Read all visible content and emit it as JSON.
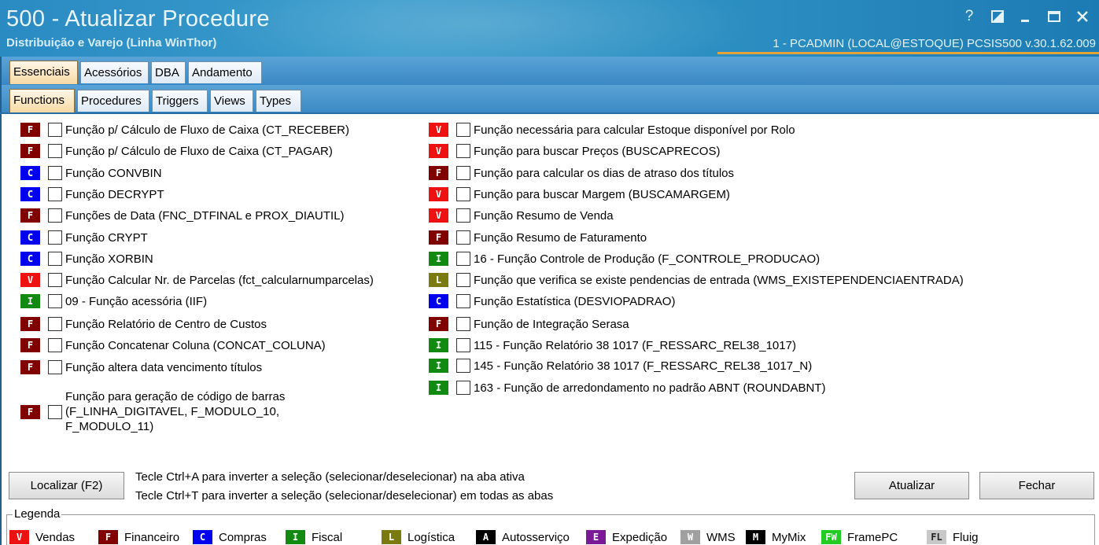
{
  "window": {
    "title": "500 - Atualizar Procedure",
    "subtitle": "Distribuição e Varejo (Linha WinThor)",
    "user_info": "1 - PCADMIN (LOCAL@ESTOQUE)   PCSIS500  v.30.1.62.009",
    "controls": [
      "help-icon",
      "restore-icon",
      "minimize-icon",
      "maximize-icon",
      "close-icon"
    ]
  },
  "colors": {
    "V": "#ee1111",
    "F": "#800000",
    "C": "#0000ee",
    "I": "#128a12",
    "L": "#7a7a10",
    "A": "#000000",
    "E": "#7a1a96",
    "W": "#a0a0a0",
    "M": "#000000",
    "FW": "#22cc22",
    "FL": "#c8c8c8"
  },
  "tabs_main": [
    "Essenciais",
    "Acessórios",
    "DBA",
    "Andamento"
  ],
  "tabs_sub": [
    "Functions",
    "Procedures",
    "Triggers",
    "Views",
    "Types"
  ],
  "left_items": [
    {
      "code": "F",
      "label": "Função p/ Cálculo de Fluxo de Caixa (CT_RECEBER)"
    },
    {
      "code": "F",
      "label": "Função p/ Cálculo de Fluxo de Caixa (CT_PAGAR)"
    },
    {
      "code": "C",
      "label": "Função CONVBIN"
    },
    {
      "code": "C",
      "label": "Função DECRYPT"
    },
    {
      "code": "F",
      "label": "Funções de Data (FNC_DTFINAL e PROX_DIAUTIL)"
    },
    {
      "code": "C",
      "label": "Função CRYPT"
    },
    {
      "code": "C",
      "label": "Função XORBIN"
    },
    {
      "code": "V",
      "label": "Função Calcular Nr. de Parcelas (fct_calcularnumparcelas)"
    },
    {
      "code": "I",
      "label": "09 - Função acessória (IIF)"
    },
    {
      "code": "F",
      "label": "Função Relatório de Centro de Custos"
    },
    {
      "code": "F",
      "label": "Função Concatenar Coluna (CONCAT_COLUNA)"
    },
    {
      "code": "F",
      "label": "Função altera data vencimento títulos"
    },
    {
      "code": "F",
      "label": "Função para geração de código de barras\n(F_LINHA_DIGITAVEL, F_MODULO_10,\nF_MODULO_11)"
    }
  ],
  "right_items": [
    {
      "code": "V",
      "label": "Função necessária para calcular Estoque disponível por Rolo"
    },
    {
      "code": "V",
      "label": "Função para buscar Preços (BUSCAPRECOS)"
    },
    {
      "code": "F",
      "label": "Função para calcular os dias de atraso dos títulos"
    },
    {
      "code": "V",
      "label": "Função para buscar Margem (BUSCAMARGEM)"
    },
    {
      "code": "V",
      "label": "Função Resumo de Venda"
    },
    {
      "code": "F",
      "label": "Função Resumo de Faturamento"
    },
    {
      "code": "I",
      "label": "16 - Função Controle de Produção (F_CONTROLE_PRODUCAO)"
    },
    {
      "code": "L",
      "label": "Função que verifica se existe pendencias de entrada (WMS_EXISTEPENDENCIAENTRADA)"
    },
    {
      "code": "C",
      "label": "Função Estatística (DESVIOPADRAO)"
    },
    {
      "code": "F",
      "label": "Função de Integração Serasa"
    },
    {
      "code": "I",
      "label": "115 - Função Relatório 38 1017 (F_RESSARC_REL38_1017)"
    },
    {
      "code": "I",
      "label": "145 - Função Relatório 38 1017 (F_RESSARC_REL38_1017_N)"
    },
    {
      "code": "I",
      "label": "163 - Função de arredondamento no padrão ABNT (ROUNDABNT)"
    }
  ],
  "buttons": {
    "localizar": "Localizar (F2)",
    "atualizar": "Atualizar",
    "fechar": "Fechar"
  },
  "hints": [
    "Tecle Ctrl+A para inverter a seleção (selecionar/deselecionar) na aba ativa",
    "Tecle Ctrl+T para inverter a seleção (selecionar/deselecionar) em todas as abas"
  ],
  "legend": {
    "title": "Legenda",
    "items": [
      {
        "code": "V",
        "label": "Vendas"
      },
      {
        "code": "F",
        "label": "Financeiro"
      },
      {
        "code": "C",
        "label": "Compras"
      },
      {
        "code": "I",
        "label": "Fiscal"
      },
      {
        "code": "L",
        "label": "Logística"
      },
      {
        "code": "A",
        "label": "Autosserviço"
      },
      {
        "code": "E",
        "label": "Expedição"
      },
      {
        "code": "W",
        "label": "WMS"
      },
      {
        "code": "M",
        "label": "MyMix"
      },
      {
        "code": "FW",
        "label": "FramePC"
      },
      {
        "code": "FL",
        "label": "Fluig"
      }
    ]
  }
}
